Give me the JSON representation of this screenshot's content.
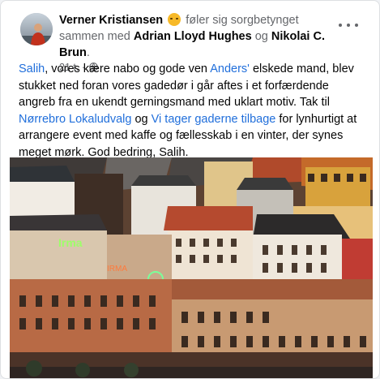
{
  "post": {
    "author": "Verner Kristiansen",
    "feeling_text": "føler sig sorgbetynget sammen med",
    "tagged_1": "Adrian Lloyd Hughes",
    "connector": "og",
    "tagged_2": "Nikolai C. Brun",
    "end_punct": ".",
    "time": "21 t.",
    "separator": "·",
    "body": {
      "t1": "Salih",
      "t2": ", vores kære nabo og gode ven ",
      "t3": "Anders'",
      "t4": " elskede mand, blev stukket ned foran vores gadedør i går aftes i et forfærdende angreb fra en ukendt gerningsmand med uklart motiv. Tak til ",
      "t5": "Nørrebro Lokaludvalg",
      "t6": " og ",
      "t7": "Vi tager gaderne tilbage",
      "t8": " for lynhurtigt at arrangere event med kaffe og fællesskab i en vinter, der synes meget mørk. God bedring, Salih."
    }
  },
  "colors": {
    "link": "#216fdb",
    "secondary_text": "#65676b",
    "card_bg": "#ffffff",
    "page_bg": "#f0f2f5"
  },
  "icons": {
    "feeling": "sad-face-emoji-icon",
    "privacy": "globe-icon",
    "menu": "more-horizontal-icon"
  }
}
